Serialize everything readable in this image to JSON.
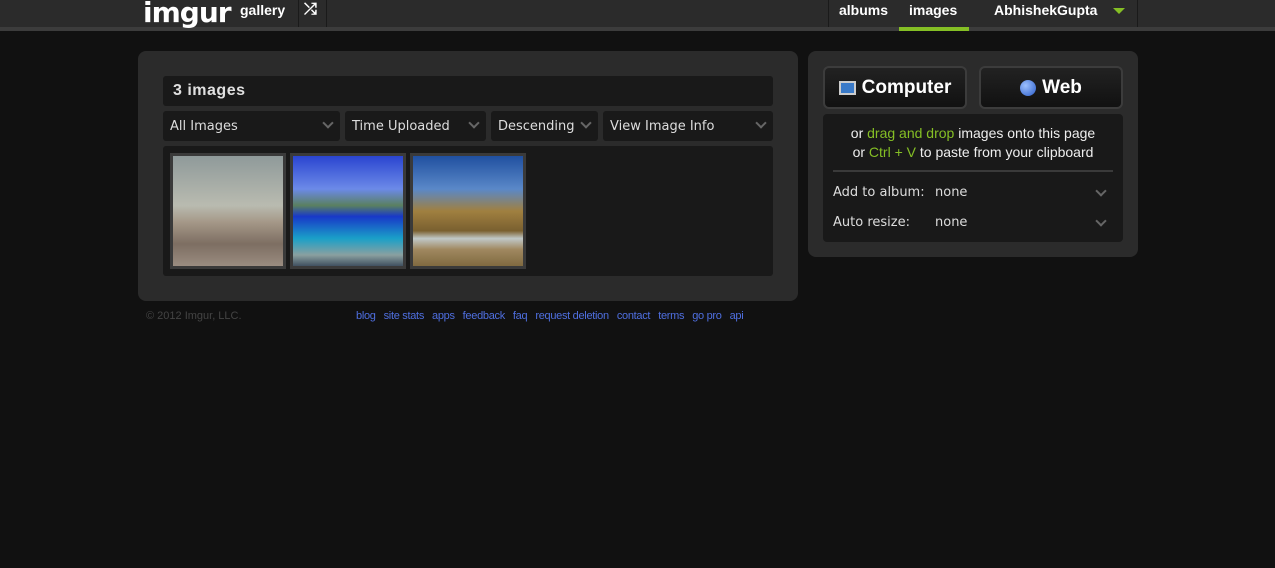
{
  "nav": {
    "logo": "imgur",
    "gallery": "gallery",
    "albums": "albums",
    "images": "images",
    "user": "AbhishekGupta"
  },
  "main": {
    "count": "3 images",
    "dropdowns": [
      "All Images",
      "Time Uploaded",
      "Descending",
      "View Image Info"
    ],
    "thumbnails": [
      "mountains",
      "tropical-sailboat",
      "rock-arch-beach"
    ]
  },
  "upload": {
    "computer": "Computer",
    "web": "Web",
    "line1": {
      "a": "or ",
      "b": "drag and drop",
      "c": " images onto this page"
    },
    "line2": {
      "a": "or ",
      "b": "Ctrl + V",
      "c": " to paste from your clipboard"
    },
    "album_label": "Add to album:",
    "album_value": "none",
    "resize_label": "Auto resize:",
    "resize_value": "none"
  },
  "footer": {
    "copyright": "© 2012 Imgur, LLC.",
    "links": [
      "blog",
      "site stats",
      "apps",
      "feedback",
      "faq",
      "request deletion",
      "contact",
      "terms",
      "go pro",
      "api"
    ]
  },
  "colors": {
    "accent": "#85bf25",
    "link": "#4f6fe0"
  }
}
